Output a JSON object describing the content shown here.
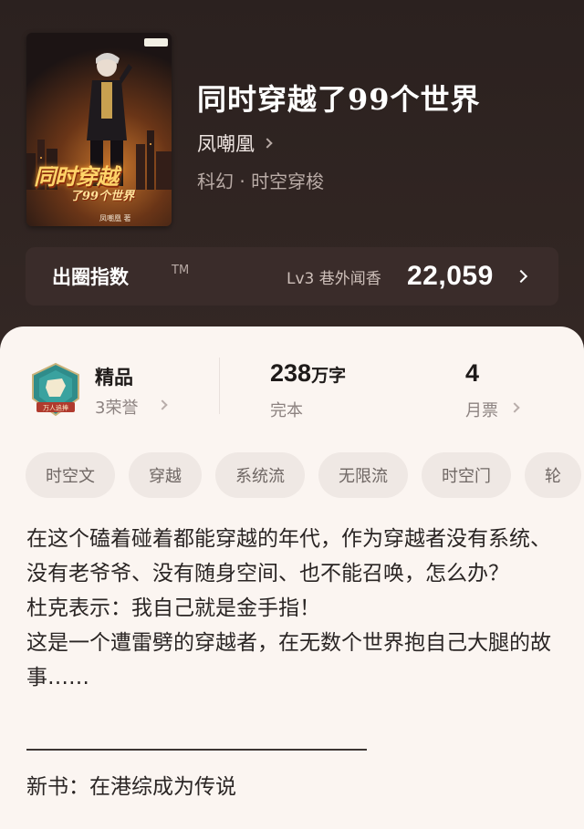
{
  "book": {
    "title": "同时穿越了99个世界",
    "author": "凤嘲凰",
    "genre": "科幻 · 时空穿梭",
    "cover": {
      "title": "同时穿越",
      "subtitle": "了99个世界",
      "author": "凤嘲凰 著"
    }
  },
  "index": {
    "label": "出圈指数",
    "tm": "TM",
    "level": "Lv3 巷外闻香",
    "value": "22,059"
  },
  "stats": {
    "honor": {
      "title": "精品",
      "sub": "3荣誉",
      "medal_text": "万人追捧"
    },
    "words": {
      "value": "238",
      "unit": "万字",
      "sub": "完本"
    },
    "tickets": {
      "value": "4",
      "sub": "月票"
    }
  },
  "tags": [
    "时空文",
    "穿越",
    "系统流",
    "无限流",
    "时空门",
    "轮"
  ],
  "description": [
    "在这个磕着碰着都能穿越的年代，作为穿越者没有系统、没有老爷爷、没有随身空间、也不能召唤，怎么办？",
    "杜克表示：我自己就是金手指！",
    "这是一个遭雷劈的穿越者，在无数个世界抱自己大腿的故事……"
  ],
  "new_book": "新书：在港综成为传说",
  "colors": {
    "header_bg": "#2f2421",
    "sheet_bg": "#fbf5f1",
    "tag_bg": "#efe8e4",
    "medal_teal": "#2f8c8a"
  }
}
